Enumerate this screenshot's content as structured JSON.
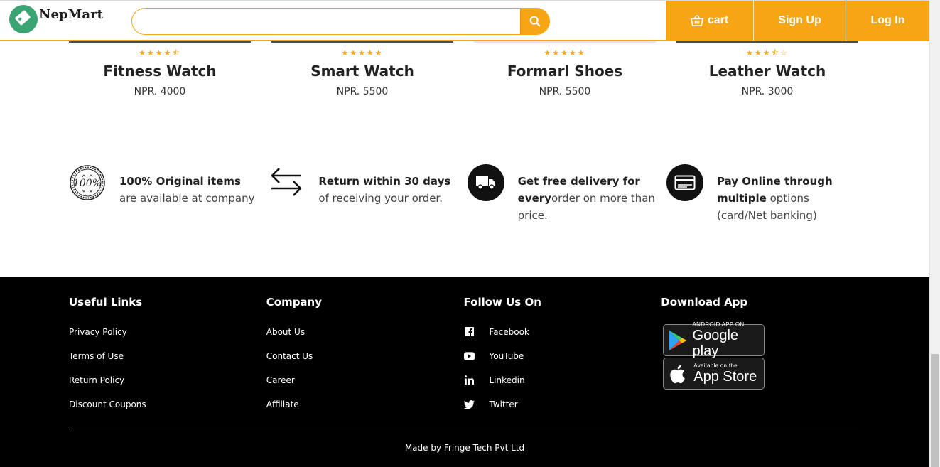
{
  "header": {
    "logo_text": "NepMart",
    "search_placeholder": "",
    "nav": {
      "cart": "cart",
      "signup": "Sign Up",
      "login": "Log In"
    },
    "accent_color": "#f6a514"
  },
  "products": [
    {
      "name": "Fitness Watch",
      "price": "NPR. 4000",
      "rating": 4.5,
      "stars": "★★★★⯪"
    },
    {
      "name": "Smart Watch",
      "price": "NPR. 5500",
      "rating": 5,
      "stars": "★★★★★"
    },
    {
      "name": "Formarl Shoes",
      "price": "NPR. 5500",
      "rating": 5,
      "stars": "★★★★★"
    },
    {
      "name": "Leather Watch",
      "price": "NPR. 3000",
      "rating": 3.5,
      "stars": "★★★⯪☆"
    }
  ],
  "features": [
    {
      "icon": "guarantee-seal-icon",
      "bold": "100% Original items",
      "text": " are available at company"
    },
    {
      "icon": "return-arrows-icon",
      "bold": "Return within 30 days",
      "text": " of receiving your order."
    },
    {
      "icon": "delivery-truck-icon",
      "bold": "Get free delivery for every",
      "text": "order on more than price."
    },
    {
      "icon": "credit-card-icon",
      "bold": "Pay Online through multiple",
      "text": " options (card/Net banking)"
    }
  ],
  "footer": {
    "useful_links": {
      "title": "Useful Links",
      "items": [
        "Privacy Policy",
        "Terms of Use",
        "Return Policy",
        "Discount Coupons"
      ]
    },
    "company": {
      "title": "Company",
      "items": [
        "About Us",
        "Contact Us",
        "Career",
        "Affiliate"
      ]
    },
    "follow": {
      "title": "Follow Us On",
      "items": [
        {
          "icon": "facebook-icon",
          "label": "Facebook"
        },
        {
          "icon": "youtube-icon",
          "label": "YouTube"
        },
        {
          "icon": "linkedin-icon",
          "label": "Linkedin"
        },
        {
          "icon": "twitter-icon",
          "label": "Twitter"
        }
      ]
    },
    "download": {
      "title": "Download App",
      "google_small": "ANDROID APP ON",
      "google_big": "Google play",
      "apple_small": "Available on the",
      "apple_big": "App Store"
    },
    "credit": "Made by Fringe Tech Pvt Ltd"
  }
}
